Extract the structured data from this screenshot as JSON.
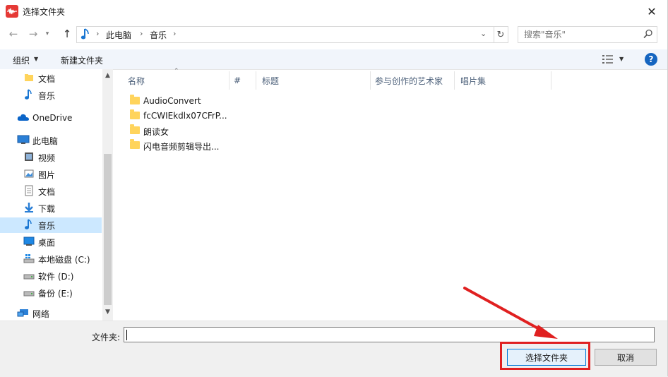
{
  "window": {
    "title": "选择文件夹",
    "close_icon": "✕",
    "app_icon": "waveform-app-icon"
  },
  "nav": {
    "back_icon": "arrow-left-icon",
    "forward_icon": "arrow-right-icon",
    "recent_icon": "chevron-down-icon",
    "up_icon": "arrow-up-icon",
    "breadcrumb": [
      "此电脑",
      "音乐"
    ],
    "refresh_icon": "refresh-icon"
  },
  "search": {
    "placeholder": "搜索\"音乐\"",
    "icon": "search-icon"
  },
  "toolbar": {
    "organize_label": "组织",
    "new_folder_label": "新建文件夹",
    "view_icon": "view-details-icon",
    "help_label": "?"
  },
  "sidebar": {
    "items": [
      {
        "label": "文档",
        "icon": "folder-icon"
      },
      {
        "label": "音乐",
        "icon": "music-note-icon"
      },
      {
        "label": "OneDrive",
        "icon": "cloud-icon"
      },
      {
        "label": "此电脑",
        "icon": "computer-icon"
      },
      {
        "label": "视频",
        "icon": "video-icon"
      },
      {
        "label": "图片",
        "icon": "picture-icon"
      },
      {
        "label": "文档",
        "icon": "document-icon"
      },
      {
        "label": "下载",
        "icon": "download-icon"
      },
      {
        "label": "音乐",
        "icon": "music-note-icon",
        "selected": true
      },
      {
        "label": "桌面",
        "icon": "desktop-icon"
      },
      {
        "label": "本地磁盘 (C:)",
        "icon": "windows-drive-icon"
      },
      {
        "label": "软件 (D:)",
        "icon": "drive-icon"
      },
      {
        "label": "备份 (E:)",
        "icon": "drive-icon"
      },
      {
        "label": "网络",
        "icon": "network-icon"
      }
    ]
  },
  "columns": [
    "名称",
    "#",
    "标题",
    "参与创作的艺术家",
    "唱片集"
  ],
  "files": [
    {
      "name": "AudioConvert"
    },
    {
      "name": "fcCWIEkdlx07CFrP..."
    },
    {
      "name": "朗读女"
    },
    {
      "name": "闪电音频剪辑导出..."
    }
  ],
  "bottom": {
    "folder_label": "文件夹:",
    "folder_value": "",
    "select_button": "选择文件夹",
    "cancel_button": "取消"
  },
  "colors": {
    "accent": "#0078d7",
    "selected_bg": "#cce8ff",
    "annotation_red": "#e02020",
    "folder_yellow": "#ffd45c"
  }
}
